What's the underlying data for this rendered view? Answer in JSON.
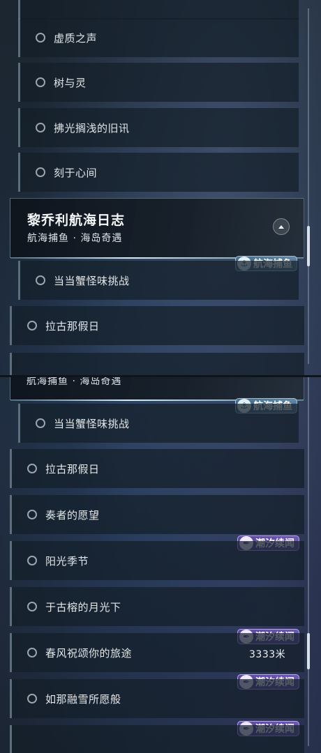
{
  "top_panel": {
    "sub_items_before": [
      "虚质之声",
      "树与灵",
      "拂光搁浅的旧讯",
      "刻于心间"
    ],
    "header": {
      "title": "黎乔利航海日志",
      "subtitle": "航海捕鱼 · 海岛奇遇"
    },
    "header_tag": "航海捕鱼",
    "sub_items_after": [
      "当当蟹怪味挑战"
    ],
    "top_items": [
      "拉古那假日"
    ]
  },
  "bottom_panel": {
    "header_subtitle_partial": "航海捕鱼 · 海岛奇遇",
    "header_tag": "航海捕鱼",
    "sub_items": [
      "当当蟹怪味挑战"
    ],
    "top_items": [
      "拉古那假日",
      "奏者的愿望",
      "阳光季节",
      "于古榕的月光下",
      "春风祝颂你的旅途",
      "如那融雪所愿般"
    ],
    "tide_tag": "潮汐续闻",
    "distance": "3333米"
  },
  "icons": {
    "radio": "radio-empty-icon",
    "collapse": "chevron-up-icon",
    "fishing": "anchor-icon",
    "tide": "feather-icon"
  },
  "colors": {
    "tag_purple": "#6c58b5",
    "tag_blue": "#6a8ca8",
    "accent_line": "#cfefff"
  }
}
